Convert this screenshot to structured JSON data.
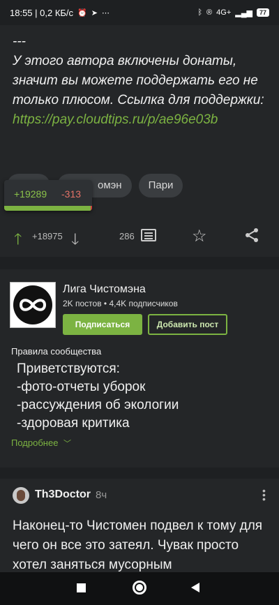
{
  "status_bar": {
    "time_and_speed": "18:55 | 0,2 КБ/с",
    "alarm_icon": "alarm-icon",
    "telegram_icon": "telegram-icon",
    "more": "⋯",
    "network": "4G+",
    "battery": "77"
  },
  "post": {
    "separator": "---",
    "text": "У этого автора включены донаты, значит вы можете поддержать его не только плюсом. Ссылка для поддержки:",
    "link": "https://pay.cloudtips.ru/p/ae96e03b",
    "tags": [
      "",
      "омэн",
      "Пари"
    ],
    "rating_plus": "+19289",
    "rating_minus": "-313",
    "rating_fraction_positive": 0.984,
    "score": "+18975",
    "comments_count": "286"
  },
  "community": {
    "name": "Лига Чистомэна",
    "stats": "2K постов • 4,4K подписчиков",
    "subscribe_label": "Подписаться",
    "add_post_label": "Добавить пост",
    "rules_title": "Правила сообщества",
    "rules": [
      "Приветствуются:",
      "-фото-отчеты уборок",
      "-рассуждения об экологии",
      "-здоровая критика"
    ],
    "more_label": "Подробнее"
  },
  "comment": {
    "author": "Th3Doctor",
    "time": "8ч",
    "text": "Наконец-то Чистомен подвел к тому для чего он все это затеял. Чувак просто хотел заняться мусорным"
  },
  "colors": {
    "accent": "#7cb342",
    "negative": "#e57368",
    "background": "#1e2022",
    "card": "#242628"
  }
}
